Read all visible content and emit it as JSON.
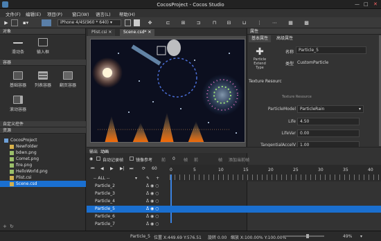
{
  "window": {
    "title": "CocosProject - Cocos Studio",
    "min": "—",
    "max": "□",
    "close": "✕"
  },
  "menu": [
    "文件(F)",
    "编辑(E)",
    "项目(P)",
    "窗口(W)",
    "语言(L)",
    "帮助(H)"
  ],
  "toolbar": {
    "resolution": "iPhone 4/4S(960 * 640)"
  },
  "left": {
    "objects_header": "对象",
    "objects": [
      {
        "label": "滑动条",
        "icon": "slider-icon"
      },
      {
        "label": "输入框",
        "icon": "textfield-icon"
      }
    ],
    "containers_header": "容器",
    "containers": [
      {
        "label": "基础容器",
        "icon": "panel-icon"
      },
      {
        "label": "列表容器",
        "icon": "list-icon"
      },
      {
        "label": "翻页容器",
        "icon": "pageview-icon"
      },
      {
        "label": "滚动容器",
        "icon": "scrollview-icon"
      }
    ],
    "custom_header": "自定义控件",
    "resources_header": "资源",
    "tree": [
      {
        "label": "CocosProject",
        "indent": 0,
        "color": "#6ea0d8"
      },
      {
        "label": "NewFolder",
        "indent": 1,
        "color": "#d9b24a"
      },
      {
        "label": "bdwn.png",
        "indent": 1,
        "color": "#9bbf6a"
      },
      {
        "label": "Comet.png",
        "indent": 1,
        "color": "#9bbf6a"
      },
      {
        "label": "fire.png",
        "indent": 1,
        "color": "#9bbf6a"
      },
      {
        "label": "HelloWorld.png",
        "indent": 1,
        "color": "#9bbf6a"
      },
      {
        "label": "Plist.csi",
        "indent": 1,
        "color": "#d0b050"
      },
      {
        "label": "Scene.csd",
        "indent": 1,
        "color": "#d0b050",
        "selected": true
      }
    ]
  },
  "tabs": [
    {
      "label": "Plist.csi",
      "close": "✕"
    },
    {
      "label": "Scene.csd*",
      "close": "✕",
      "active": true
    }
  ],
  "right": {
    "header": "属性",
    "tabs": [
      "基本属性",
      "高级属性"
    ],
    "node_type_label": "Particle Extend Type",
    "name_label": "名称",
    "name_value": "Particle_5",
    "type_label": "类型",
    "type_value": "CustomParticle",
    "section": "Texture Resourc",
    "texture_hint": "Texture Resource",
    "props": [
      {
        "label": "ParticleModel",
        "value": "ParticleRain",
        "dropdown": true
      },
      {
        "label": "Life",
        "value": "4.50"
      },
      {
        "label": "LifeVar",
        "value": "0.00"
      },
      {
        "label": "TangentialAccelV",
        "value": "1.00"
      }
    ]
  },
  "timeline": {
    "tabs": [
      "输出",
      "动画"
    ],
    "auto_record": "自动记录帧",
    "mirror": "镜像参考",
    "frame_prefix": "前",
    "frame_value": "0",
    "frame_unit": "帧",
    "frame_prefix2": "前",
    "frame_unit2": "帧",
    "add_frame": "添加当前帧",
    "fps": "60",
    "filter": "-- ALL --",
    "ruler": [
      "0",
      "5",
      "10",
      "15",
      "20",
      "25",
      "30",
      "35",
      "40"
    ],
    "rows": [
      {
        "name": "Particle_2"
      },
      {
        "name": "Particle_3"
      },
      {
        "name": "Particle_4"
      },
      {
        "name": "Particle_5",
        "selected": true
      },
      {
        "name": "Particle_6"
      },
      {
        "name": "Particle_7"
      }
    ]
  },
  "status": {
    "name": "Particle_5",
    "pos": "位置 X:449.69  Y:576.51",
    "rot": "旋转 0.00",
    "scale": "缩放 X:100.00%  Y:100.00%",
    "zoom": "49%"
  }
}
